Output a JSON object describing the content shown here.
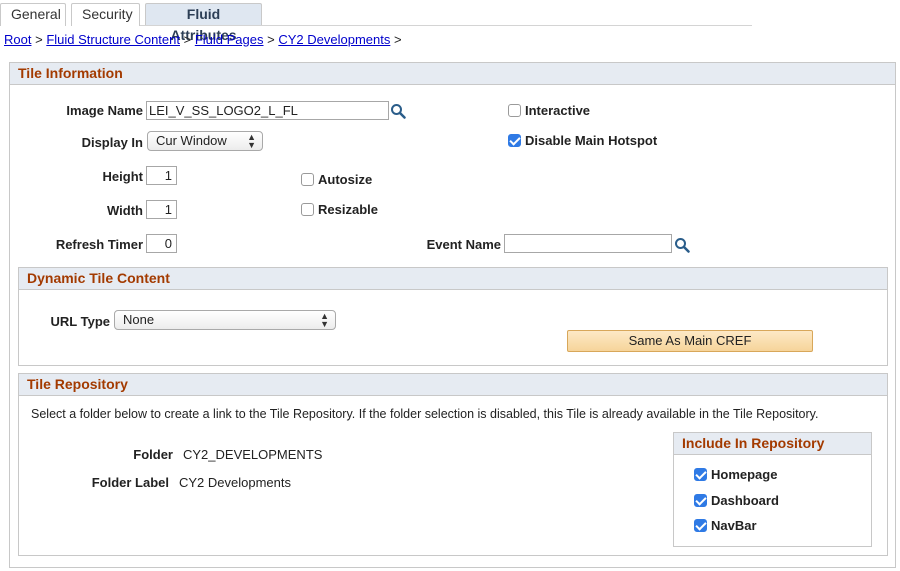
{
  "tabs": [
    {
      "label": "General"
    },
    {
      "label": "Security"
    },
    {
      "label": "Fluid Attributes"
    }
  ],
  "breadcrumb": {
    "items": [
      "Root",
      "Fluid Structure Content",
      "Fluid Pages",
      "CY2 Developments"
    ],
    "separator": ">"
  },
  "tile_information": {
    "title": "Tile Information",
    "image_name_label": "Image Name",
    "image_name_value": "LEI_V_SS_LOGO2_L_FL",
    "display_in_label": "Display In",
    "display_in_value": "Cur Window",
    "height_label": "Height",
    "height_value": "1",
    "width_label": "Width",
    "width_value": "1",
    "refresh_timer_label": "Refresh Timer",
    "refresh_timer_value": "0",
    "interactive_label": "Interactive",
    "interactive_checked": false,
    "disable_main_hotspot_label": "Disable Main Hotspot",
    "disable_main_hotspot_checked": true,
    "autosize_label": "Autosize",
    "autosize_checked": false,
    "resizable_label": "Resizable",
    "resizable_checked": false,
    "event_name_label": "Event Name",
    "event_name_value": ""
  },
  "dynamic_tile_content": {
    "title": "Dynamic Tile Content",
    "url_type_label": "URL Type",
    "url_type_value": "None",
    "same_as_main_button": "Same As Main CREF"
  },
  "tile_repository": {
    "title": "Tile Repository",
    "info_text": "Select a folder below to create a link to the Tile Repository. If the folder selection is disabled, this Tile is already available in the Tile Repository.",
    "folder_label": "Folder",
    "folder_value": "CY2_DEVELOPMENTS",
    "folder_label_label": "Folder Label",
    "folder_label_value": "CY2 Developments"
  },
  "include_in_repository": {
    "title": "Include In Repository",
    "items": [
      {
        "label": "Homepage",
        "checked": true
      },
      {
        "label": "Dashboard",
        "checked": true
      },
      {
        "label": "NavBar",
        "checked": true
      }
    ]
  },
  "colors": {
    "section_title": "#a33a00",
    "header_bg": "#e6ebf2",
    "checkbox_on": "#2f7ae5",
    "button_bg": "#f6d49a",
    "link": "#0000cc"
  }
}
